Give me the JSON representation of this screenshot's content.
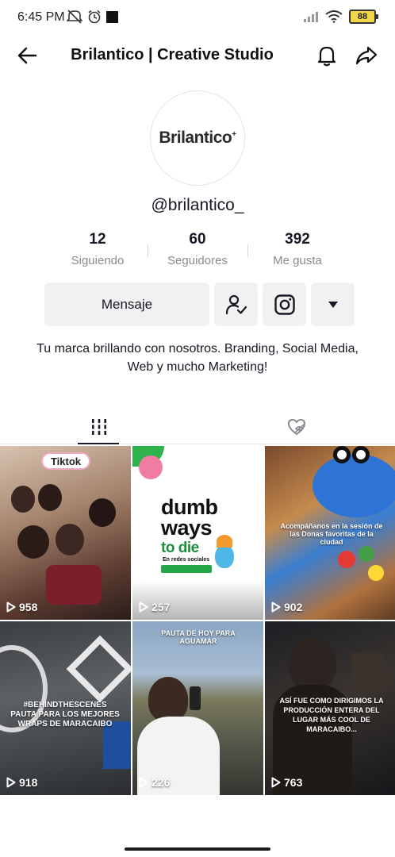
{
  "status_bar": {
    "time": "6:45 PM",
    "battery": "88",
    "left_icons": [
      "mute-icon",
      "alarm-icon",
      "square-icon"
    ],
    "right_icons": [
      "signal-icon",
      "wifi-icon",
      "battery-icon"
    ]
  },
  "header": {
    "title": "Brilantico | Creative Studio",
    "icons": [
      "back-arrow-icon",
      "bell-icon",
      "share-icon"
    ]
  },
  "profile": {
    "avatar_text": "Brilantico",
    "avatar_mark": "+",
    "username": "@brilantico_",
    "stats": [
      {
        "value": "12",
        "label": "Siguiendo"
      },
      {
        "value": "60",
        "label": "Seguidores"
      },
      {
        "value": "392",
        "label": "Me gusta"
      }
    ],
    "message_button": "Mensaje",
    "bio": "Tu marca brillando con nosotros. Branding, Social Media, Web y mucho Marketing!"
  },
  "tabs": [
    {
      "name": "videos",
      "icon": "grid-icon",
      "active": true
    },
    {
      "name": "liked",
      "icon": "liked-hidden-icon",
      "active": false
    }
  ],
  "videos": [
    {
      "views": "958",
      "overlay": "Tiktok"
    },
    {
      "views": "257",
      "overlay_title": [
        "dumb",
        "ways",
        "to die"
      ],
      "overlay_sub": "En redes sociales"
    },
    {
      "views": "902",
      "overlay": "Acompáñanos en la sesión de las Donas favoritas de la ciudad"
    },
    {
      "views": "918",
      "overlay": "#BEHINDTHESCENES PAUTA PARA LOS MEJORES WRAPS DE MARACAIBO"
    },
    {
      "views": "226",
      "overlay": "PAUTA DE HOY PARA AGUAMAR"
    },
    {
      "views": "763",
      "overlay": "ASÍ FUE COMO DIRIGIMOS LA PRODUCCIÓN ENTERA DEL LUGAR MÁS COOL DE MARACAIBO..."
    }
  ],
  "colors": {
    "button_bg": "#f1f1f2",
    "text_primary": "#161823",
    "text_secondary": "#8a8b91",
    "battery": "#f2d64a"
  }
}
